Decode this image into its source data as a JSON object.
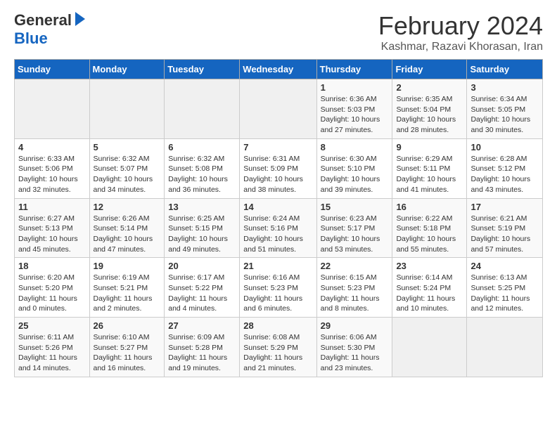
{
  "logo": {
    "general": "General",
    "blue": "Blue"
  },
  "title": "February 2024",
  "location": "Kashmar, Razavi Khorasan, Iran",
  "days_of_week": [
    "Sunday",
    "Monday",
    "Tuesday",
    "Wednesday",
    "Thursday",
    "Friday",
    "Saturday"
  ],
  "weeks": [
    [
      {
        "day": "",
        "info": ""
      },
      {
        "day": "",
        "info": ""
      },
      {
        "day": "",
        "info": ""
      },
      {
        "day": "",
        "info": ""
      },
      {
        "day": "1",
        "info": "Sunrise: 6:36 AM\nSunset: 5:03 PM\nDaylight: 10 hours and 27 minutes."
      },
      {
        "day": "2",
        "info": "Sunrise: 6:35 AM\nSunset: 5:04 PM\nDaylight: 10 hours and 28 minutes."
      },
      {
        "day": "3",
        "info": "Sunrise: 6:34 AM\nSunset: 5:05 PM\nDaylight: 10 hours and 30 minutes."
      }
    ],
    [
      {
        "day": "4",
        "info": "Sunrise: 6:33 AM\nSunset: 5:06 PM\nDaylight: 10 hours and 32 minutes."
      },
      {
        "day": "5",
        "info": "Sunrise: 6:32 AM\nSunset: 5:07 PM\nDaylight: 10 hours and 34 minutes."
      },
      {
        "day": "6",
        "info": "Sunrise: 6:32 AM\nSunset: 5:08 PM\nDaylight: 10 hours and 36 minutes."
      },
      {
        "day": "7",
        "info": "Sunrise: 6:31 AM\nSunset: 5:09 PM\nDaylight: 10 hours and 38 minutes."
      },
      {
        "day": "8",
        "info": "Sunrise: 6:30 AM\nSunset: 5:10 PM\nDaylight: 10 hours and 39 minutes."
      },
      {
        "day": "9",
        "info": "Sunrise: 6:29 AM\nSunset: 5:11 PM\nDaylight: 10 hours and 41 minutes."
      },
      {
        "day": "10",
        "info": "Sunrise: 6:28 AM\nSunset: 5:12 PM\nDaylight: 10 hours and 43 minutes."
      }
    ],
    [
      {
        "day": "11",
        "info": "Sunrise: 6:27 AM\nSunset: 5:13 PM\nDaylight: 10 hours and 45 minutes."
      },
      {
        "day": "12",
        "info": "Sunrise: 6:26 AM\nSunset: 5:14 PM\nDaylight: 10 hours and 47 minutes."
      },
      {
        "day": "13",
        "info": "Sunrise: 6:25 AM\nSunset: 5:15 PM\nDaylight: 10 hours and 49 minutes."
      },
      {
        "day": "14",
        "info": "Sunrise: 6:24 AM\nSunset: 5:16 PM\nDaylight: 10 hours and 51 minutes."
      },
      {
        "day": "15",
        "info": "Sunrise: 6:23 AM\nSunset: 5:17 PM\nDaylight: 10 hours and 53 minutes."
      },
      {
        "day": "16",
        "info": "Sunrise: 6:22 AM\nSunset: 5:18 PM\nDaylight: 10 hours and 55 minutes."
      },
      {
        "day": "17",
        "info": "Sunrise: 6:21 AM\nSunset: 5:19 PM\nDaylight: 10 hours and 57 minutes."
      }
    ],
    [
      {
        "day": "18",
        "info": "Sunrise: 6:20 AM\nSunset: 5:20 PM\nDaylight: 11 hours and 0 minutes."
      },
      {
        "day": "19",
        "info": "Sunrise: 6:19 AM\nSunset: 5:21 PM\nDaylight: 11 hours and 2 minutes."
      },
      {
        "day": "20",
        "info": "Sunrise: 6:17 AM\nSunset: 5:22 PM\nDaylight: 11 hours and 4 minutes."
      },
      {
        "day": "21",
        "info": "Sunrise: 6:16 AM\nSunset: 5:23 PM\nDaylight: 11 hours and 6 minutes."
      },
      {
        "day": "22",
        "info": "Sunrise: 6:15 AM\nSunset: 5:23 PM\nDaylight: 11 hours and 8 minutes."
      },
      {
        "day": "23",
        "info": "Sunrise: 6:14 AM\nSunset: 5:24 PM\nDaylight: 11 hours and 10 minutes."
      },
      {
        "day": "24",
        "info": "Sunrise: 6:13 AM\nSunset: 5:25 PM\nDaylight: 11 hours and 12 minutes."
      }
    ],
    [
      {
        "day": "25",
        "info": "Sunrise: 6:11 AM\nSunset: 5:26 PM\nDaylight: 11 hours and 14 minutes."
      },
      {
        "day": "26",
        "info": "Sunrise: 6:10 AM\nSunset: 5:27 PM\nDaylight: 11 hours and 16 minutes."
      },
      {
        "day": "27",
        "info": "Sunrise: 6:09 AM\nSunset: 5:28 PM\nDaylight: 11 hours and 19 minutes."
      },
      {
        "day": "28",
        "info": "Sunrise: 6:08 AM\nSunset: 5:29 PM\nDaylight: 11 hours and 21 minutes."
      },
      {
        "day": "29",
        "info": "Sunrise: 6:06 AM\nSunset: 5:30 PM\nDaylight: 11 hours and 23 minutes."
      },
      {
        "day": "",
        "info": ""
      },
      {
        "day": "",
        "info": ""
      }
    ]
  ]
}
